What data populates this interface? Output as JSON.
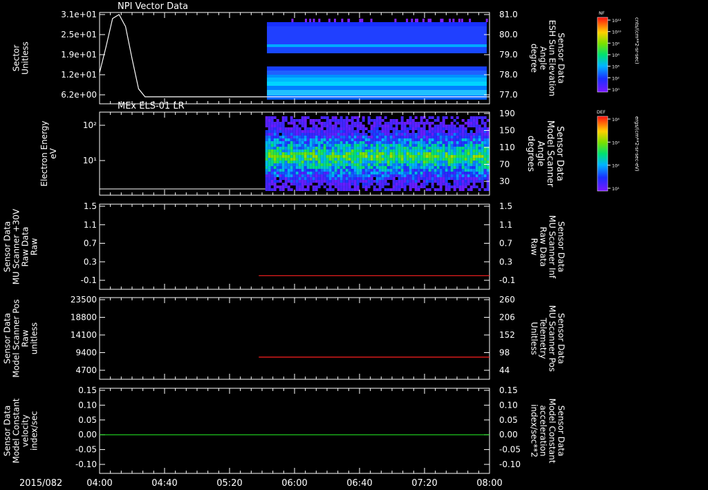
{
  "date_label": "2015/082",
  "colors": {
    "white": "#ffffff",
    "red": "#ff2020",
    "green": "#22dd22"
  },
  "colorbars": [
    {
      "title": "NF",
      "ticks": [
        "10¹²",
        "10¹⁰",
        "10⁸",
        "10⁶",
        "10⁴",
        "10²",
        "10⁰"
      ],
      "unit": "cnts/(cm**2-sr-sec)"
    },
    {
      "title": "DEF",
      "ticks": [
        "10⁴",
        "10³",
        "10²",
        "10¹"
      ],
      "unit": "ergs/(cm**2-sr-sec-eV)"
    }
  ],
  "chart_data": [
    {
      "type": "heatmap",
      "title": "NPI Vector Data",
      "ylabel_lines": [
        "Sector",
        "Unitless"
      ],
      "y_ticks": [
        "3.1e+01",
        "2.5e+01",
        "1.9e+01",
        "1.2e+01",
        "6.2e+00"
      ],
      "right_label_lines": [
        "Sensor Data",
        "ESH Sun Elevation",
        "Angle",
        "degree"
      ],
      "right_ticks": [
        "81.0",
        "80.0",
        "79.0",
        "78.0",
        "77.0"
      ],
      "x_ticks": [
        "04:00",
        "04:40",
        "05:20",
        "06:00",
        "06:40",
        "07:20",
        "08:00"
      ],
      "line_series": {
        "name": "ESH Sun Elevation Angle",
        "x": [
          "04:00",
          "04:04",
          "04:08",
          "04:12",
          "04:16",
          "04:20",
          "04:24",
          "04:28",
          "04:32",
          "04:36",
          "05:43",
          "08:00"
        ],
        "y": [
          78.1,
          79.4,
          80.8,
          81.0,
          80.4,
          78.8,
          77.3,
          76.9,
          76.9,
          76.9,
          76.9,
          76.9
        ]
      },
      "heatmap_start": "05:43"
    },
    {
      "type": "heatmap",
      "title": "MEx ELS-01 LR",
      "ylabel_lines": [
        "Electron Energy",
        "eV"
      ],
      "y_ticks": [
        "10²",
        "10¹"
      ],
      "right_label_lines": [
        "Sensor Data",
        "Model Scanner",
        "Angle",
        "degrees"
      ],
      "right_ticks": [
        "190",
        "150",
        "110",
        "70",
        "30"
      ],
      "heatmap_start": "05:42"
    },
    {
      "type": "line",
      "ylabel_lines": [
        "Sensor Data",
        "MU Scanner +30V",
        "Raw Data",
        "Raw"
      ],
      "y_ticks": [
        "1.5",
        "1.1",
        "0.7",
        "0.3",
        "-0.1"
      ],
      "right_label_lines": [
        "Sensor Data",
        "MU Scanner Inf",
        "Raw Data",
        "Raw"
      ],
      "right_ticks": [
        "1.5",
        "1.1",
        "0.7",
        "0.3",
        "-0.1"
      ],
      "ylim": [
        -0.5,
        1.5
      ],
      "series": [
        {
          "color": "red",
          "x": [
            "05:38",
            "08:00"
          ],
          "y": [
            0.0,
            0.0
          ]
        }
      ]
    },
    {
      "type": "line",
      "ylabel_lines": [
        "Sensor Data",
        "Model Scanner Pos",
        "Raw",
        "unitless"
      ],
      "y_ticks": [
        "23500",
        "18800",
        "14100",
        "9400",
        "4700"
      ],
      "right_label_lines": [
        "Sensor Data",
        "MU Scanner Pos",
        "Telemetry",
        "Unitless"
      ],
      "right_ticks": [
        "260",
        "206",
        "152",
        "98",
        "44"
      ],
      "ylim": [
        0,
        23500
      ],
      "series": [
        {
          "color": "red",
          "x": [
            "05:38",
            "08:00"
          ],
          "y": [
            8200,
            8200
          ]
        }
      ]
    },
    {
      "type": "line",
      "ylabel_lines": [
        "Sensor Data",
        "Model Constant",
        "velocity",
        "index/sec"
      ],
      "y_ticks": [
        "0.15",
        "0.10",
        "0.05",
        "0.00",
        "-0.05",
        "-0.10"
      ],
      "right_label_lines": [
        "Sensor Data",
        "Model Constant",
        "acceleration",
        "index/sec**2"
      ],
      "right_ticks": [
        "0.15",
        "0.10",
        "0.05",
        "0.00",
        "-0.05",
        "-0.10"
      ],
      "ylim": [
        -0.1,
        0.15
      ],
      "series": [
        {
          "color": "green",
          "x": [
            "04:00",
            "08:00"
          ],
          "y": [
            0.0,
            0.0
          ]
        }
      ]
    }
  ]
}
